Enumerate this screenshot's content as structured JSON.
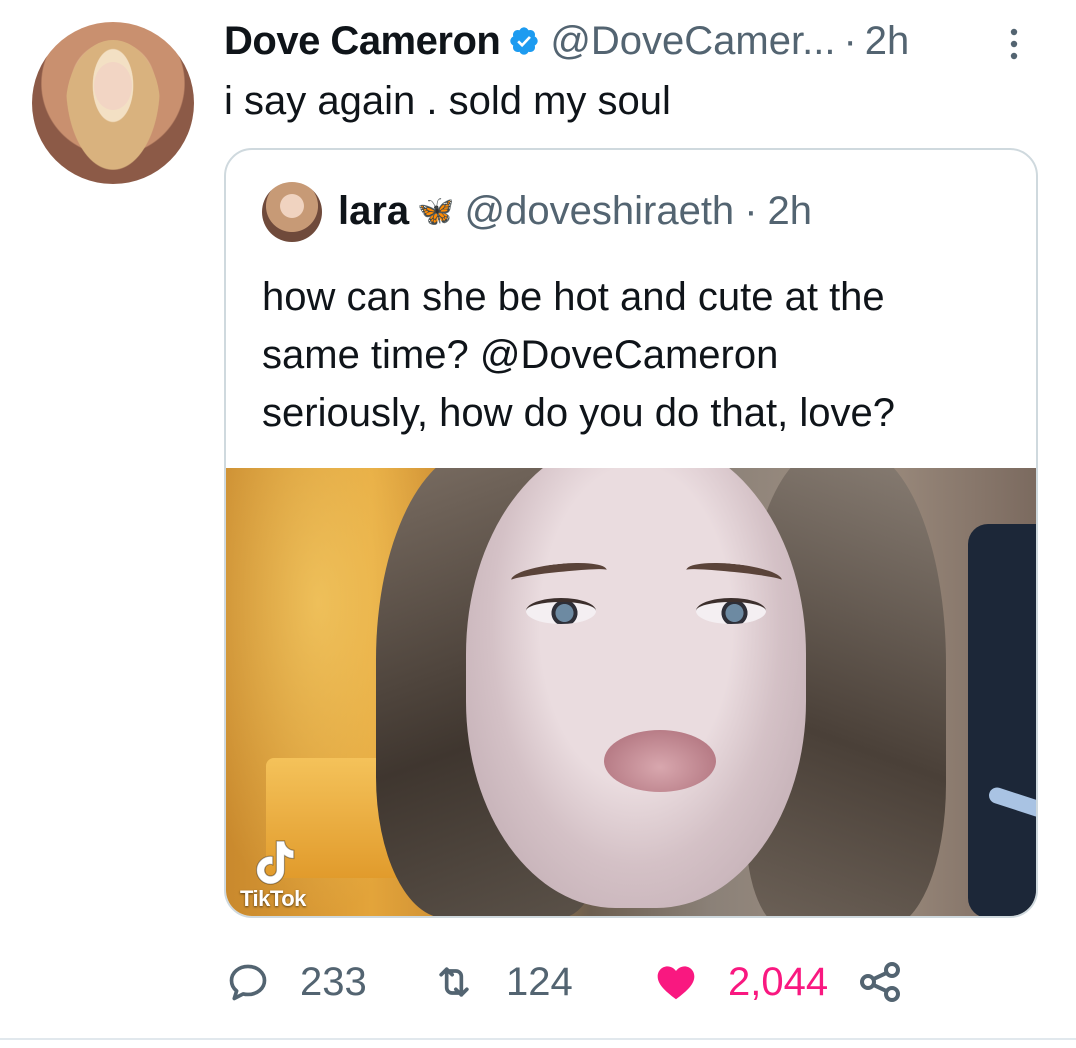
{
  "tweet": {
    "author_name": "Dove Cameron",
    "author_handle": "@DoveCamer...",
    "separator": "·",
    "time": "2h",
    "text": "i say again . sold my soul",
    "verified_color": "#1d9bf0"
  },
  "quoted_tweet": {
    "author_name": "lara",
    "author_emoji": "🦋",
    "author_handle": "@doveshiraeth",
    "separator": "·",
    "time": "2h",
    "text_lines": [
      "how can she be hot and cute at the",
      "same time? @DoveCameron",
      "seriously, how do you do that, love?"
    ],
    "media_watermark": "TikTok"
  },
  "actions": {
    "reply_count": "233",
    "retweet_count": "124",
    "like_count": "2,044",
    "like_color": "#f91880",
    "reply_icon": "reply-icon",
    "retweet_icon": "retweet-icon",
    "like_icon": "heart-icon",
    "share_icon": "share-icon"
  }
}
